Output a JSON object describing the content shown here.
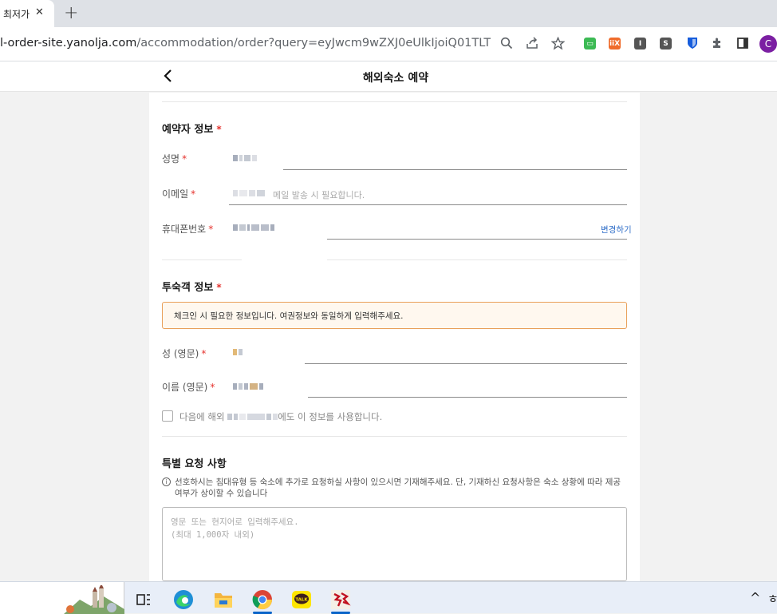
{
  "browser": {
    "tab_title": "최저가",
    "tab_close": "✕",
    "new_tab": "+",
    "url_host": "l-order-site.yanolja.com",
    "url_path": "/accommodation/order?query=eyJwcm9wZXJ0eUlkIjoiQ01TLTE2MjY1Mj...",
    "profile_initial": "C",
    "extensions": [
      "ext-green",
      "ext-orange",
      "ext-gray-i",
      "ext-gray-s",
      "bitwarden-icon"
    ]
  },
  "header": {
    "back": "〈",
    "title": "해외숙소 예약"
  },
  "booker": {
    "title": "예약자 정보",
    "required_mark": "*",
    "name_label": "성명",
    "email_label": "이메일",
    "email_hint": "메일 발송 시 필요합니다.",
    "phone_label": "휴대폰번호",
    "change_link": "변경하기"
  },
  "guest": {
    "title": "투숙객 정보",
    "notice": "체크인 시 필요한 정보입니다. 여권정보와 동일하게 입력해주세요.",
    "last_name_label": "성 (영문)",
    "first_name_label": "이름 (영문)",
    "checkbox_prefix": "다음에 해외",
    "checkbox_suffix": "에도 이 정보를 사용합니다."
  },
  "special": {
    "title": "특별 요청 사항",
    "info_icon": "i",
    "info_text": "선호하시는 침대유형 등 숙소에 추가로 요청하실 사항이 있으시면 기재해주세요. 단, 기재하신 요청사항은 숙소 상황에 따라 제공 여부가 상이할 수 있습니다",
    "placeholder_line1": "영문 또는 현지어로 입력해주세요.",
    "placeholder_line2": "(최대 1,000자 내외)"
  },
  "taskbar": {
    "tray_up": "^",
    "tray_text": "ㅎ",
    "apps": [
      "task-view-icon",
      "edge-icon",
      "file-explorer-icon",
      "chrome-icon",
      "kakaotalk-icon",
      "game-icon"
    ]
  },
  "colors": {
    "accent_blue": "#2f6ec8",
    "required_red": "#e5322d",
    "notice_border": "#e9a05a",
    "notice_bg": "#fff8ef"
  }
}
